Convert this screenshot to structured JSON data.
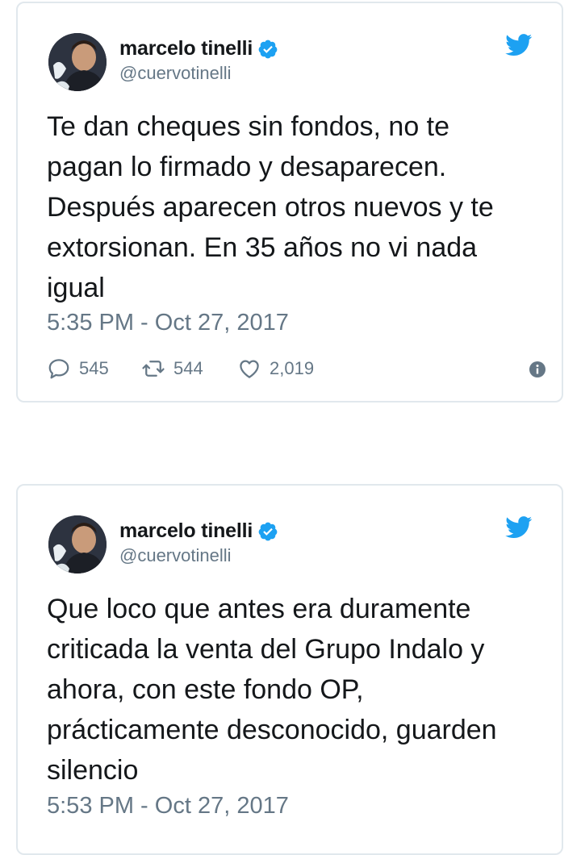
{
  "tweets": [
    {
      "display_name": "marcelo tinelli",
      "handle": "@cuervotinelli",
      "text": "Te dan cheques sin fondos, no te\npagan lo firmado y desaparecen.\nDespués aparecen otros nuevos y te\nextorsionan. En 35 años no vi nada\nigual",
      "timestamp": "5:35 PM - Oct 27, 2017",
      "replies": "545",
      "retweets": "544",
      "likes": "2,019"
    },
    {
      "display_name": "marcelo tinelli",
      "handle": "@cuervotinelli",
      "text": "Que loco que antes era duramente\ncriticada la venta del Grupo Indalo y\nahora, con este fondo OP,\nprácticamente desconocido, guarden\nsilencio",
      "timestamp": "5:53 PM - Oct 27, 2017"
    }
  ],
  "colors": {
    "twitter_blue": "#1da1f2",
    "secondary_text": "#657786",
    "border": "#e1e8ed"
  },
  "icons": [
    "verified-badge-icon",
    "twitter-bird-icon",
    "reply-icon",
    "retweet-icon",
    "like-icon",
    "info-icon"
  ]
}
